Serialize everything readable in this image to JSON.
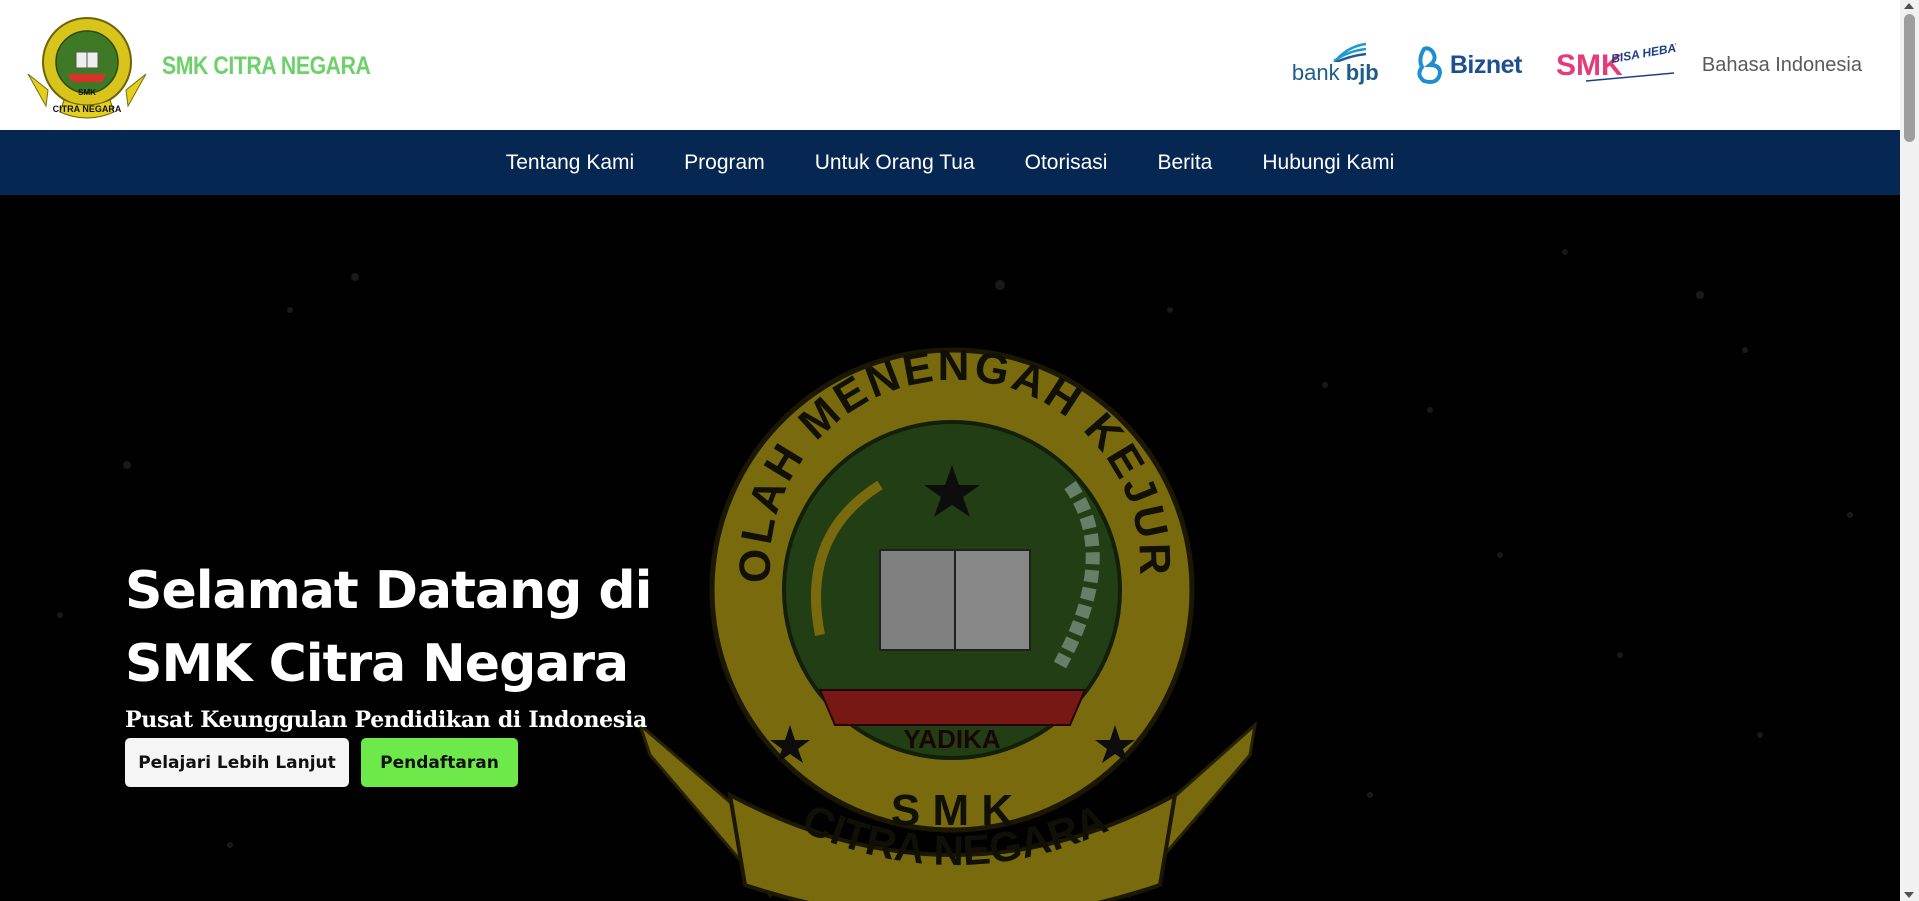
{
  "header": {
    "school_name": "SMK CITRA NEGARA",
    "logo": {
      "ring_text": "SEKOLAH MENENGAH KEJURUAN",
      "center_text": "SMK",
      "ribbon_text": "CITRA NEGARA",
      "banner_text": "YADIKA"
    },
    "partners": {
      "bank": {
        "prefix": "bank ",
        "name": "bjb"
      },
      "isp": {
        "name": "Biznet"
      },
      "smk": {
        "name": "SMK",
        "tagline": "BISA HEBAT."
      }
    },
    "language": "Bahasa Indonesia"
  },
  "nav": {
    "items": [
      "Tentang Kami",
      "Program",
      "Untuk Orang Tua",
      "Otorisasi",
      "Berita",
      "Hubungi Kami"
    ]
  },
  "hero": {
    "title": "Selamat Datang di SMK Citra Negara",
    "subtitle": "Pusat Keunggulan Pendidikan di Indonesia",
    "primary_button": "Pelajari Lebih Lanjut",
    "secondary_button": "Pendaftaran",
    "emblem": {
      "ring_text": "SEKOLAH MENENGAH KEJURUAN",
      "banner_text": "YADIKA",
      "center_text": "S M K",
      "bottom_text": "CITRA NEGARA"
    }
  },
  "colors": {
    "brand_green": "#6dd16a",
    "nav_bg": "#052752",
    "register_button": "#6dea4a",
    "emblem_yellow": "#c9b418",
    "emblem_green": "#3f6e27"
  }
}
